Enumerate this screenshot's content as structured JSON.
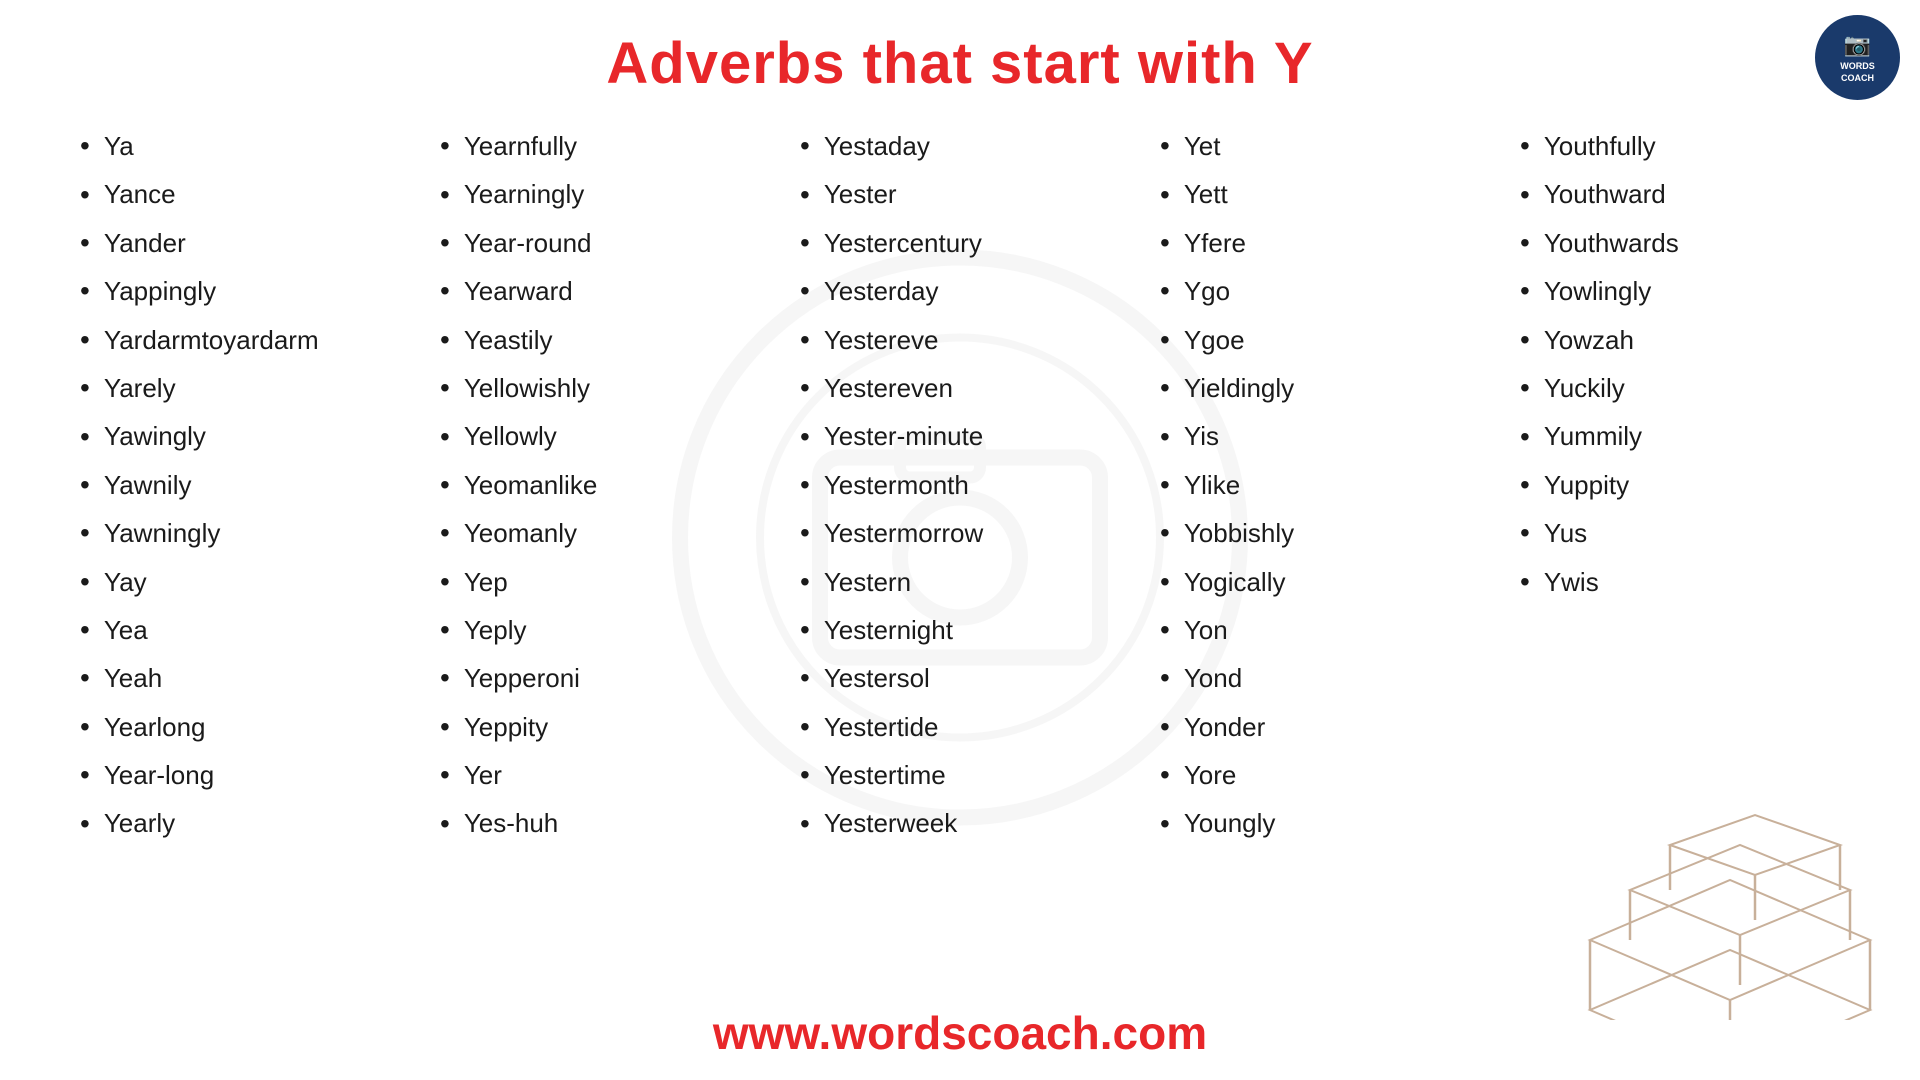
{
  "page": {
    "title": "Adverbs that start with Y",
    "footer_url": "www.wordscoach.com"
  },
  "logo": {
    "line1": "WORDS",
    "line2": "COACH"
  },
  "columns": [
    {
      "id": "col1",
      "words": [
        "Ya",
        "Yance",
        "Yander",
        "Yappingly",
        "Yardarmtoyardarm",
        "Yarely",
        "Yawingly",
        "Yawnily",
        "Yawningly",
        "Yay",
        "Yea",
        "Yeah",
        "Yearlong",
        "Year-long",
        "Yearly"
      ]
    },
    {
      "id": "col2",
      "words": [
        "Yearnfully",
        "Yearningly",
        "Year-round",
        "Yearward",
        "Yeastily",
        "Yellowishly",
        "Yellowly",
        "Yeomanlike",
        "Yeomanly",
        "Yep",
        "Yeply",
        "Yepperoni",
        "Yeppity",
        "Yer",
        "Yes-huh"
      ]
    },
    {
      "id": "col3",
      "words": [
        "Yestaday",
        "Yester",
        "Yestercentury",
        "Yesterday",
        "Yestereve",
        "Yestereven",
        "Yester-minute",
        "Yestermonth",
        "Yestermorrow",
        "Yestern",
        "Yesternight",
        "Yestersol",
        "Yestertide",
        "Yestertime",
        "Yesterweek"
      ]
    },
    {
      "id": "col4",
      "words": [
        "Yet",
        "Yett",
        "Yfere",
        "Ygo",
        "Ygoe",
        "Yieldingly",
        "Yis",
        "Ylike",
        "Yobbishly",
        "Yogically",
        "Yon",
        "Yond",
        "Yonder",
        "Yore",
        "Youngly"
      ]
    },
    {
      "id": "col5",
      "words": [
        "Youthfully",
        "Youthward",
        "Youthwards",
        "Yowlingly",
        "Yowzah",
        "Yuckily",
        "Yummily",
        "Yuppity",
        "Yus",
        "Ywis"
      ]
    }
  ]
}
